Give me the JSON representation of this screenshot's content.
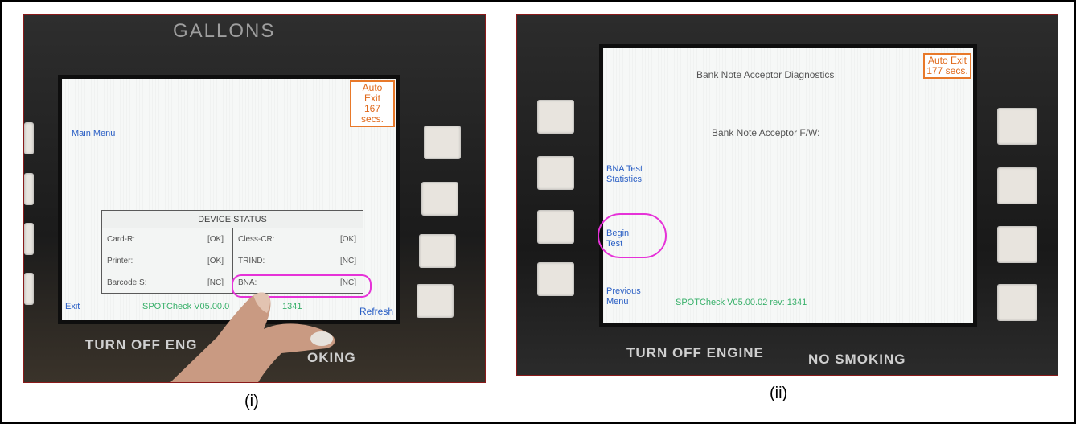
{
  "panel_i": {
    "bezel_title": "GALLONS",
    "auto_exit_line1": "Auto Exit",
    "auto_exit_line2": "167 secs.",
    "main_menu": "Main Menu",
    "device_status": {
      "title": "DEVICE STATUS",
      "left": [
        {
          "key": "Card-R:",
          "val": "[OK]"
        },
        {
          "key": "Printer:",
          "val": "[OK]"
        },
        {
          "key": "Barcode S:",
          "val": "[NC]"
        }
      ],
      "right": [
        {
          "key": "Cless-CR:",
          "val": "[OK]"
        },
        {
          "key": "TRIND:",
          "val": "[NC]"
        },
        {
          "key": "BNA:",
          "val": "[NC]"
        }
      ]
    },
    "exit": "Exit",
    "version": "SPOTCheck V05.00.0",
    "version_tail": "1341",
    "refresh": "Refresh",
    "bezel_bottom_left": "TURN OFF ENG",
    "bezel_bottom_right": "OKING",
    "caption": "(i)"
  },
  "panel_ii": {
    "screen_title": "Bank Note Acceptor Diagnostics",
    "auto_exit_line1": "Auto Exit",
    "auto_exit_line2": "177 secs.",
    "firmware_label": "Bank Note Acceptor F/W:",
    "bna_stats_line1": "BNA Test",
    "bna_stats_line2": "Statistics",
    "begin_line1": "Begin",
    "begin_line2": "Test",
    "previous_line1": "Previous",
    "previous_line2": "Menu",
    "version": "SPOTCheck V05.00.02 rev: 1341",
    "bezel_bottom_left": "TURN OFF ENGINE",
    "bezel_bottom_right": "NO SMOKING",
    "caption": "(ii)"
  },
  "colors": {
    "highlight": "#e632d8",
    "auto_exit": "#e8792a",
    "menu_blue": "#2a5fc5",
    "version_green": "#38b06a"
  }
}
